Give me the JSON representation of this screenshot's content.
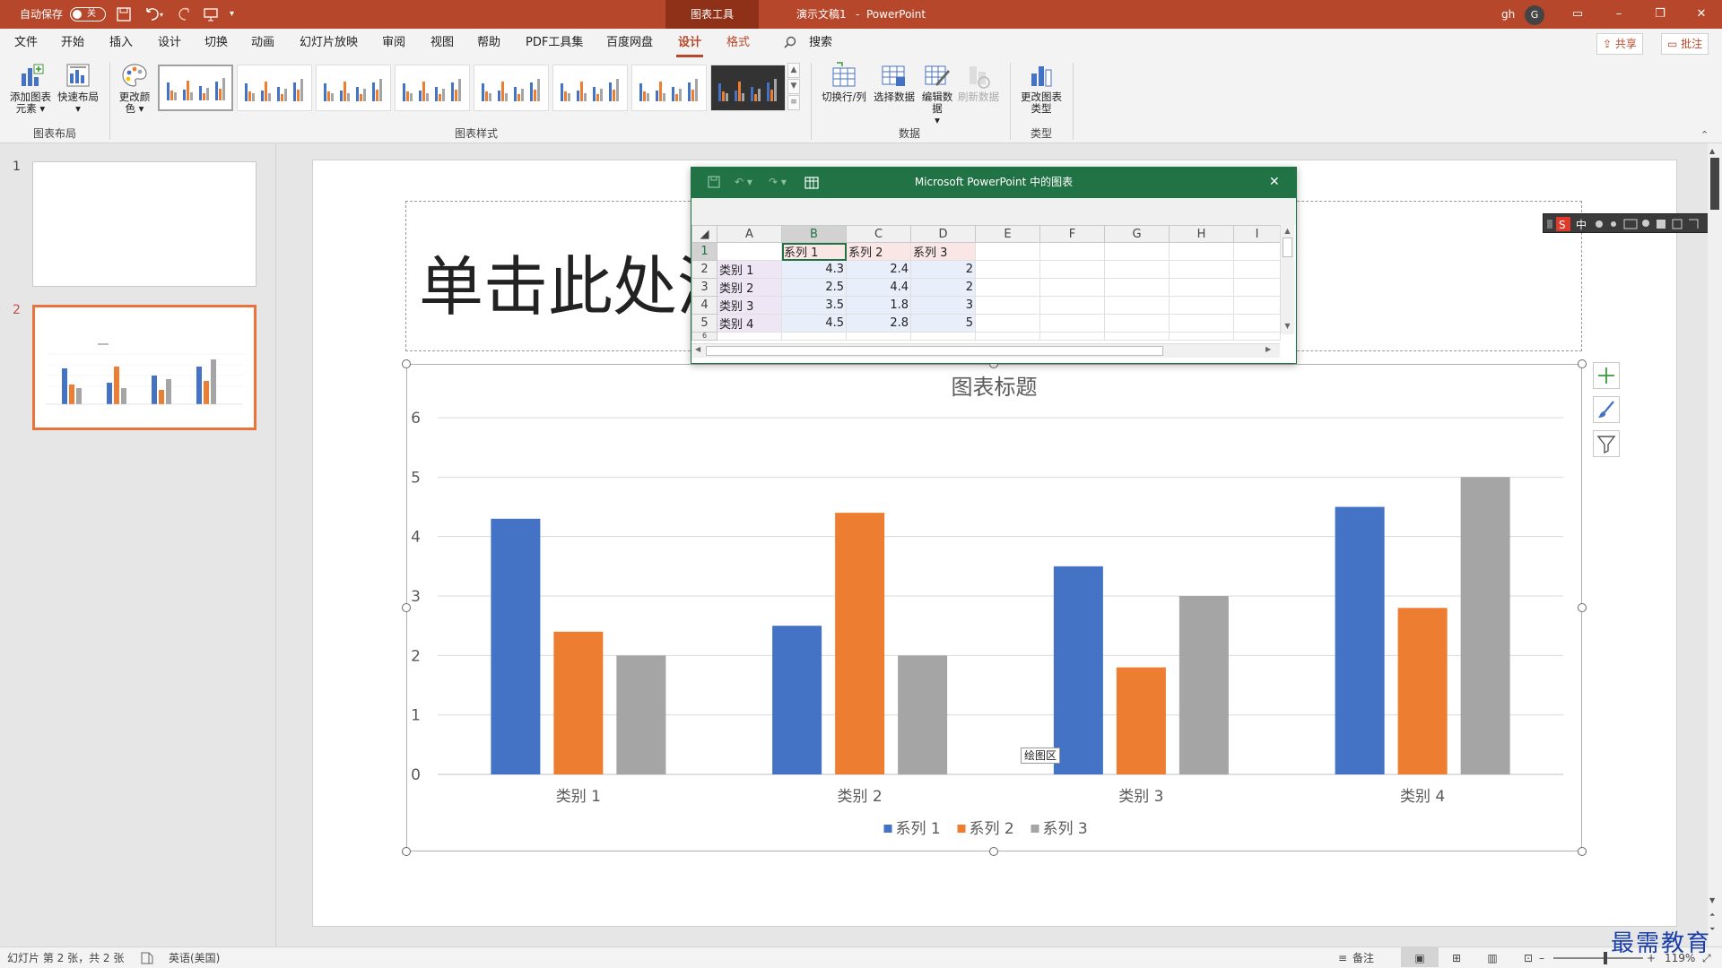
{
  "titlebar": {
    "autosave_label": "自动保存",
    "autosave_state": "关",
    "context_tab": "图表工具",
    "doc_title": "演示文稿1",
    "separator": "-",
    "app_name": "PowerPoint",
    "user_name": "gh",
    "avatar_letter": "G"
  },
  "menu": {
    "tabs": [
      "文件",
      "开始",
      "插入",
      "设计",
      "切换",
      "动画",
      "幻灯片放映",
      "审阅",
      "视图",
      "帮助",
      "PDF工具集",
      "百度网盘",
      "设计",
      "格式"
    ],
    "search": "搜索",
    "share": "共享",
    "comment": "批注"
  },
  "ribbon": {
    "add_element": "添加图表元素",
    "quick_layout": "快速布局",
    "change_color": "更改颜色",
    "switch_row_col": "切换行/列",
    "select_data": "选择数据",
    "edit_data": "编辑数据",
    "refresh_data": "刷新数据",
    "change_type": "更改图表类型",
    "groups": {
      "layout": "图表布局",
      "styles": "图表样式",
      "data": "数据",
      "type": "类型"
    }
  },
  "thumbnails": {
    "slide1": "1",
    "slide2": "2"
  },
  "slide": {
    "title_placeholder": "单击此处添加标题",
    "plot_area_tip": "绘图区"
  },
  "datawin": {
    "title": "Microsoft PowerPoint 中的图表",
    "cols": [
      "A",
      "B",
      "C",
      "D",
      "E",
      "F",
      "G",
      "H",
      "I"
    ],
    "rows": [
      [
        "1",
        "",
        "系列 1",
        "系列 2",
        "系列 3"
      ],
      [
        "2",
        "类别 1",
        "4.3",
        "2.4",
        "2"
      ],
      [
        "3",
        "类别 2",
        "2.5",
        "4.4",
        "2"
      ],
      [
        "4",
        "类别 3",
        "3.5",
        "1.8",
        "3"
      ],
      [
        "5",
        "类别 4",
        "4.5",
        "2.8",
        "5"
      ],
      [
        "6",
        "",
        "",
        "",
        ""
      ]
    ]
  },
  "chart_data": {
    "type": "bar",
    "title": "图表标题",
    "categories": [
      "类别 1",
      "类别 2",
      "类别 3",
      "类别 4"
    ],
    "series": [
      {
        "name": "系列 1",
        "values": [
          4.3,
          2.5,
          3.5,
          4.5
        ],
        "color": "#4472c4"
      },
      {
        "name": "系列 2",
        "values": [
          2.4,
          4.4,
          1.8,
          2.8
        ],
        "color": "#ed7d31"
      },
      {
        "name": "系列 3",
        "values": [
          2,
          2,
          3,
          5
        ],
        "color": "#a5a5a5"
      }
    ],
    "ylim": [
      0,
      6
    ],
    "yticks": [
      "0",
      "1",
      "2",
      "3",
      "4",
      "5",
      "6"
    ],
    "grid": true,
    "legend": "bottom"
  },
  "status": {
    "slide_info": "幻灯片 第 2 张，共 2 张",
    "language": "英语(美国)",
    "notes": "备注",
    "zoom": "119%"
  },
  "watermark": "最需教育"
}
